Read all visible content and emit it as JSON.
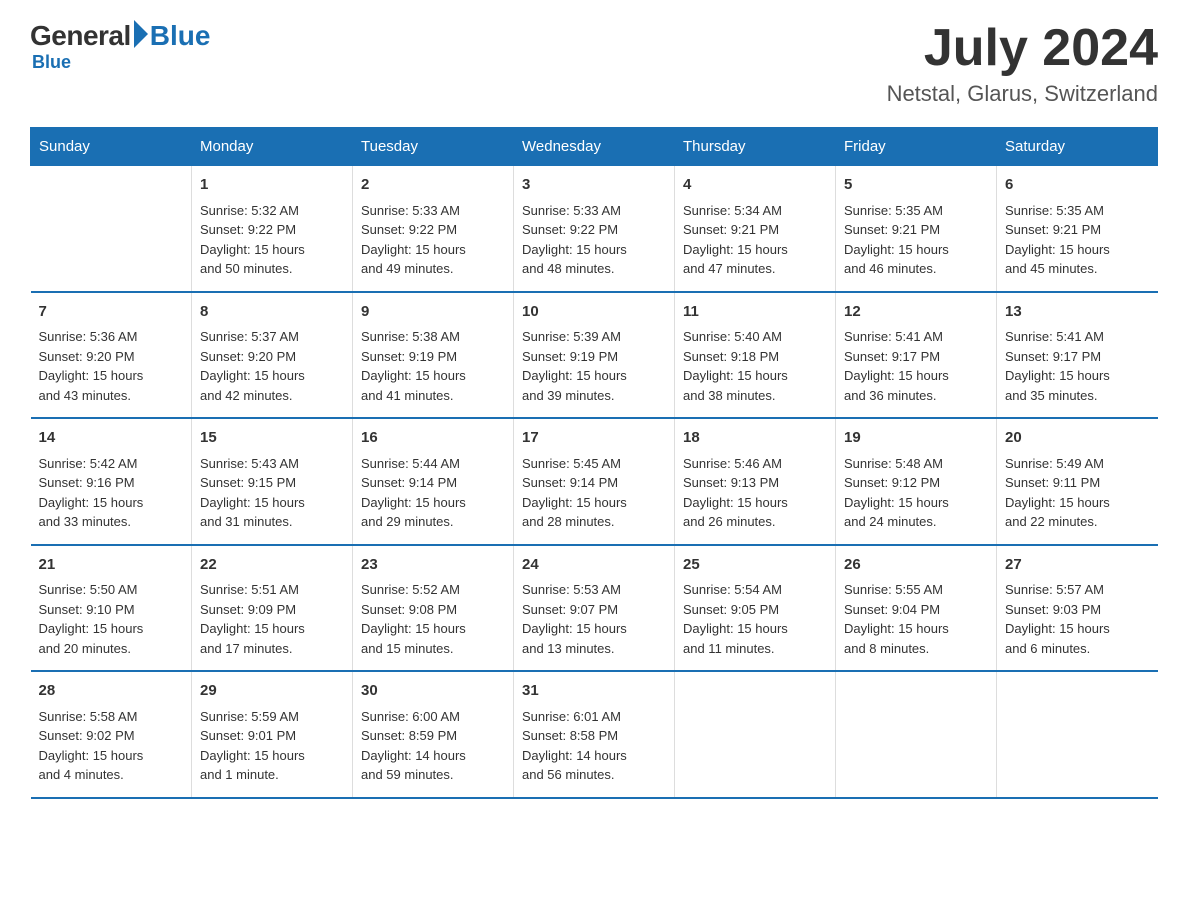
{
  "logo": {
    "general": "General",
    "blue": "Blue"
  },
  "title": {
    "month_year": "July 2024",
    "location": "Netstal, Glarus, Switzerland"
  },
  "days_of_week": [
    "Sunday",
    "Monday",
    "Tuesday",
    "Wednesday",
    "Thursday",
    "Friday",
    "Saturday"
  ],
  "weeks": [
    [
      {
        "day": "",
        "info": ""
      },
      {
        "day": "1",
        "info": "Sunrise: 5:32 AM\nSunset: 9:22 PM\nDaylight: 15 hours\nand 50 minutes."
      },
      {
        "day": "2",
        "info": "Sunrise: 5:33 AM\nSunset: 9:22 PM\nDaylight: 15 hours\nand 49 minutes."
      },
      {
        "day": "3",
        "info": "Sunrise: 5:33 AM\nSunset: 9:22 PM\nDaylight: 15 hours\nand 48 minutes."
      },
      {
        "day": "4",
        "info": "Sunrise: 5:34 AM\nSunset: 9:21 PM\nDaylight: 15 hours\nand 47 minutes."
      },
      {
        "day": "5",
        "info": "Sunrise: 5:35 AM\nSunset: 9:21 PM\nDaylight: 15 hours\nand 46 minutes."
      },
      {
        "day": "6",
        "info": "Sunrise: 5:35 AM\nSunset: 9:21 PM\nDaylight: 15 hours\nand 45 minutes."
      }
    ],
    [
      {
        "day": "7",
        "info": "Sunrise: 5:36 AM\nSunset: 9:20 PM\nDaylight: 15 hours\nand 43 minutes."
      },
      {
        "day": "8",
        "info": "Sunrise: 5:37 AM\nSunset: 9:20 PM\nDaylight: 15 hours\nand 42 minutes."
      },
      {
        "day": "9",
        "info": "Sunrise: 5:38 AM\nSunset: 9:19 PM\nDaylight: 15 hours\nand 41 minutes."
      },
      {
        "day": "10",
        "info": "Sunrise: 5:39 AM\nSunset: 9:19 PM\nDaylight: 15 hours\nand 39 minutes."
      },
      {
        "day": "11",
        "info": "Sunrise: 5:40 AM\nSunset: 9:18 PM\nDaylight: 15 hours\nand 38 minutes."
      },
      {
        "day": "12",
        "info": "Sunrise: 5:41 AM\nSunset: 9:17 PM\nDaylight: 15 hours\nand 36 minutes."
      },
      {
        "day": "13",
        "info": "Sunrise: 5:41 AM\nSunset: 9:17 PM\nDaylight: 15 hours\nand 35 minutes."
      }
    ],
    [
      {
        "day": "14",
        "info": "Sunrise: 5:42 AM\nSunset: 9:16 PM\nDaylight: 15 hours\nand 33 minutes."
      },
      {
        "day": "15",
        "info": "Sunrise: 5:43 AM\nSunset: 9:15 PM\nDaylight: 15 hours\nand 31 minutes."
      },
      {
        "day": "16",
        "info": "Sunrise: 5:44 AM\nSunset: 9:14 PM\nDaylight: 15 hours\nand 29 minutes."
      },
      {
        "day": "17",
        "info": "Sunrise: 5:45 AM\nSunset: 9:14 PM\nDaylight: 15 hours\nand 28 minutes."
      },
      {
        "day": "18",
        "info": "Sunrise: 5:46 AM\nSunset: 9:13 PM\nDaylight: 15 hours\nand 26 minutes."
      },
      {
        "day": "19",
        "info": "Sunrise: 5:48 AM\nSunset: 9:12 PM\nDaylight: 15 hours\nand 24 minutes."
      },
      {
        "day": "20",
        "info": "Sunrise: 5:49 AM\nSunset: 9:11 PM\nDaylight: 15 hours\nand 22 minutes."
      }
    ],
    [
      {
        "day": "21",
        "info": "Sunrise: 5:50 AM\nSunset: 9:10 PM\nDaylight: 15 hours\nand 20 minutes."
      },
      {
        "day": "22",
        "info": "Sunrise: 5:51 AM\nSunset: 9:09 PM\nDaylight: 15 hours\nand 17 minutes."
      },
      {
        "day": "23",
        "info": "Sunrise: 5:52 AM\nSunset: 9:08 PM\nDaylight: 15 hours\nand 15 minutes."
      },
      {
        "day": "24",
        "info": "Sunrise: 5:53 AM\nSunset: 9:07 PM\nDaylight: 15 hours\nand 13 minutes."
      },
      {
        "day": "25",
        "info": "Sunrise: 5:54 AM\nSunset: 9:05 PM\nDaylight: 15 hours\nand 11 minutes."
      },
      {
        "day": "26",
        "info": "Sunrise: 5:55 AM\nSunset: 9:04 PM\nDaylight: 15 hours\nand 8 minutes."
      },
      {
        "day": "27",
        "info": "Sunrise: 5:57 AM\nSunset: 9:03 PM\nDaylight: 15 hours\nand 6 minutes."
      }
    ],
    [
      {
        "day": "28",
        "info": "Sunrise: 5:58 AM\nSunset: 9:02 PM\nDaylight: 15 hours\nand 4 minutes."
      },
      {
        "day": "29",
        "info": "Sunrise: 5:59 AM\nSunset: 9:01 PM\nDaylight: 15 hours\nand 1 minute."
      },
      {
        "day": "30",
        "info": "Sunrise: 6:00 AM\nSunset: 8:59 PM\nDaylight: 14 hours\nand 59 minutes."
      },
      {
        "day": "31",
        "info": "Sunrise: 6:01 AM\nSunset: 8:58 PM\nDaylight: 14 hours\nand 56 minutes."
      },
      {
        "day": "",
        "info": ""
      },
      {
        "day": "",
        "info": ""
      },
      {
        "day": "",
        "info": ""
      }
    ]
  ]
}
